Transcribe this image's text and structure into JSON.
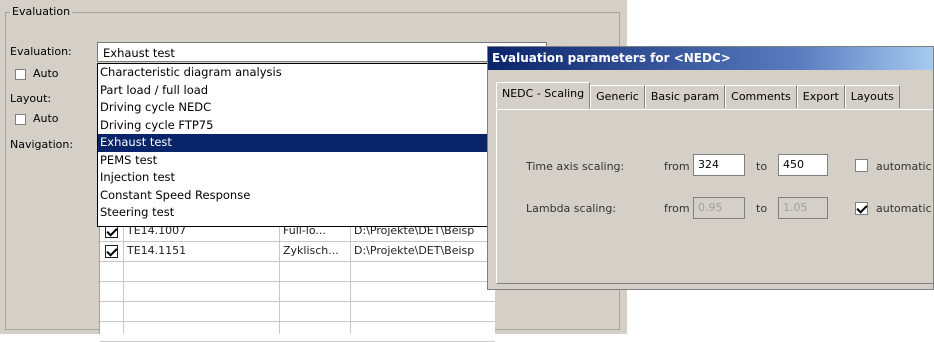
{
  "group": {
    "title": "Evaluation"
  },
  "left_labels": {
    "evaluation": "Evaluation:",
    "auto1": "Auto",
    "layout": "Layout:",
    "auto2": "Auto",
    "navigation": "Navigation:"
  },
  "combo": {
    "value": "Exhaust test"
  },
  "dropdown": {
    "items": [
      "Characteristic diagram analysis",
      "Part load / full load",
      "Driving cycle NEDC",
      "Driving cycle FTP75",
      "Exhaust test",
      "PEMS test",
      "Injection test",
      "Constant Speed Response",
      "Steering test"
    ],
    "selected": "Exhaust test"
  },
  "grid": {
    "rows": [
      {
        "name": "TE14.1007",
        "type": "Full-lo...",
        "path": "D:\\Projekte\\DET\\Beisp"
      },
      {
        "name": "TE14.1151",
        "type": "Zyklisch...",
        "path": "D:\\Projekte\\DET\\Beisp"
      }
    ]
  },
  "dialog": {
    "title": "Evaluation parameters for <NEDC>",
    "tabs": [
      "NEDC - Scaling",
      "Generic",
      "Basic param",
      "Comments",
      "Export",
      "Layouts"
    ],
    "active_tab": "NEDC - Scaling",
    "time_axis": {
      "label": "Time axis scaling:",
      "from_label": "from",
      "from": "324",
      "to_label": "to",
      "to": "450",
      "auto_label": "automatic",
      "auto_checked": false
    },
    "lambda": {
      "label": "Lambda scaling:",
      "from_label": "from",
      "from": "0.95",
      "to_label": "to",
      "to": "1.05",
      "auto_label": "automatic",
      "auto_checked": true
    }
  }
}
